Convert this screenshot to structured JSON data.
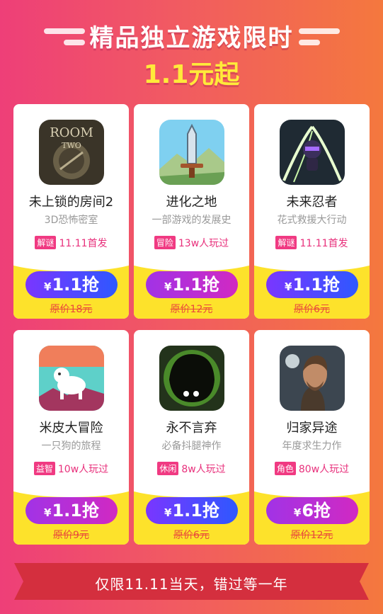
{
  "header": {
    "title": "精品独立游戏限时",
    "subtitle": "1.1元起"
  },
  "colors": {
    "title_highlight": "#ffea3a",
    "card_bottom": "#fde22b",
    "tag_bg": "#f03a82",
    "btn_blue": "#2e58ff",
    "btn_purple": "#a133e6",
    "banner": "#d42f3e"
  },
  "games": [
    {
      "name": "未上锁的房间2",
      "desc": "3D恐怖密室",
      "tag": "解谜",
      "stat": "11.11首发",
      "yen": "¥",
      "price": "1.1抢",
      "orig": "原价18元",
      "icon": "room-two-icon",
      "btn": "blue"
    },
    {
      "name": "进化之地",
      "desc": "一部游戏的发展史",
      "tag": "冒险",
      "stat": "13w人玩过",
      "yen": "¥",
      "price": "1.1抢",
      "orig": "原价12元",
      "icon": "sword-icon",
      "btn": "purple"
    },
    {
      "name": "未来忍者",
      "desc": "花式救援大行动",
      "tag": "解谜",
      "stat": "11.11首发",
      "yen": "¥",
      "price": "1.1抢",
      "orig": "原价6元",
      "icon": "ninja-icon",
      "btn": "blue"
    },
    {
      "name": "米皮大冒险",
      "desc": "一只狗的旅程",
      "tag": "益智",
      "stat": "10w人玩过",
      "yen": "¥",
      "price": "1.1抢",
      "orig": "原价9元",
      "icon": "dog-icon",
      "btn": "purple"
    },
    {
      "name": "永不言弃",
      "desc": "必备抖腿神作",
      "tag": "休闲",
      "stat": "8w人玩过",
      "yen": "¥",
      "price": "1.1抢",
      "orig": "原价6元",
      "icon": "shadow-creature-icon",
      "btn": "blue"
    },
    {
      "name": "归家异途",
      "desc": "年度求生力作",
      "tag": "角色",
      "stat": "80w人玩过",
      "yen": "¥",
      "price": "6抢",
      "orig": "原价12元",
      "icon": "survivor-portrait-icon",
      "btn": "purple"
    }
  ],
  "footer": {
    "text": "仅限11.11当天，错过等一年"
  }
}
